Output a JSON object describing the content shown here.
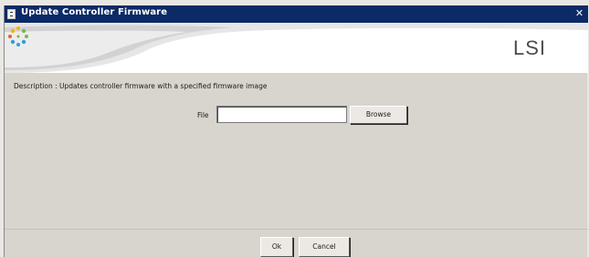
{
  "window": {
    "title": "Update Controller Firmware",
    "close_glyph": "✕"
  },
  "brand": {
    "logo_text": "LSI",
    "logo_icon": "lsi-starburst-icon",
    "colors": {
      "title_bar": "#0b2a66",
      "dialog_bg": "#d8d4ce",
      "logo_dots": [
        "#f4b400",
        "#7ab648",
        "#2f9fd8",
        "#e8632b"
      ]
    }
  },
  "description": "Description : Updates controller firmware with a specified firmware image",
  "file": {
    "label": "File",
    "value": "",
    "browse_label": "Browse"
  },
  "footer": {
    "ok_label": "Ok",
    "cancel_label": "Cancel"
  }
}
